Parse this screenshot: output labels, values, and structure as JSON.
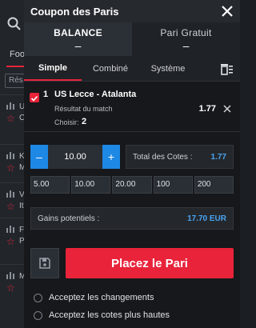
{
  "background": {
    "tab_label": "Foot",
    "input_placeholder": "Rés",
    "rows": [
      {
        "text": "U C"
      },
      {
        "text": "K M"
      },
      {
        "text": "V It"
      },
      {
        "text": "F P"
      },
      {
        "text": "M"
      }
    ]
  },
  "coupon": {
    "title": "Coupon des Paris",
    "balance_label": "BALANCE",
    "balance_value": "–",
    "free_bet_label": "Pari Gratuit",
    "free_bet_value": "–",
    "tabs": [
      "Simple",
      "Combiné",
      "Système"
    ],
    "active_tab": "Simple",
    "bet": {
      "index": "1",
      "match": "US Lecce - Atalanta",
      "market": "Résultat du match",
      "odd": "1.77",
      "choose_label": "Choisir:",
      "choose_value": "2"
    },
    "stake": {
      "minus": "–",
      "value": "10.00",
      "plus": "+"
    },
    "total_odds_label": "Total des Cotes :",
    "total_odds_value": "1.77",
    "quick_amounts": [
      "5.00",
      "10.00",
      "20.00",
      "100",
      "200"
    ],
    "gains_label": "Gains potentiels :",
    "gains_value": "17.70 EUR",
    "place_bet_label": "Placez le Pari",
    "options": [
      "Acceptez les changements",
      "Acceptez les cotes plus hautes"
    ]
  },
  "colors": {
    "accent_red": "#e8233a",
    "accent_blue": "#1e88e5",
    "value_blue": "#4aa3f0"
  }
}
